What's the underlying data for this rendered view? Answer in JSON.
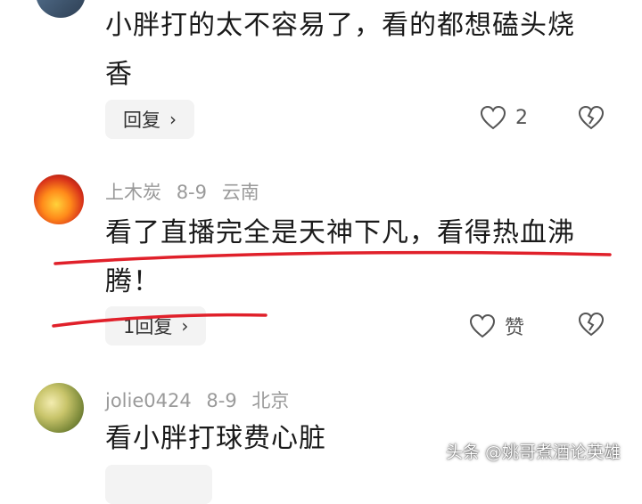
{
  "comments": [
    {
      "user": "",
      "date": "",
      "location": "",
      "text_line1": "小胖打的太不容易了，看的都想磕头烧",
      "text_line2": "香",
      "reply_label": "回复",
      "like_count": "2"
    },
    {
      "user": "上木炭",
      "date": "8-9",
      "location": "云南",
      "text_line1": "看了直播完全是天神下凡，看得热血沸",
      "text_line2": "腾！",
      "reply_label": "1回复",
      "like_label": "赞"
    },
    {
      "user": "jolie0424",
      "date": "8-9",
      "location": "北京",
      "text_line1": "看小胖打球费心脏",
      "text_line2": ""
    }
  ],
  "watermark": "头条 @姚哥煮酒论英雄",
  "colors": {
    "annotation_red": "#e0202a",
    "meta_gray": "#9a9a9a",
    "reply_bg": "#f3f3f3"
  }
}
